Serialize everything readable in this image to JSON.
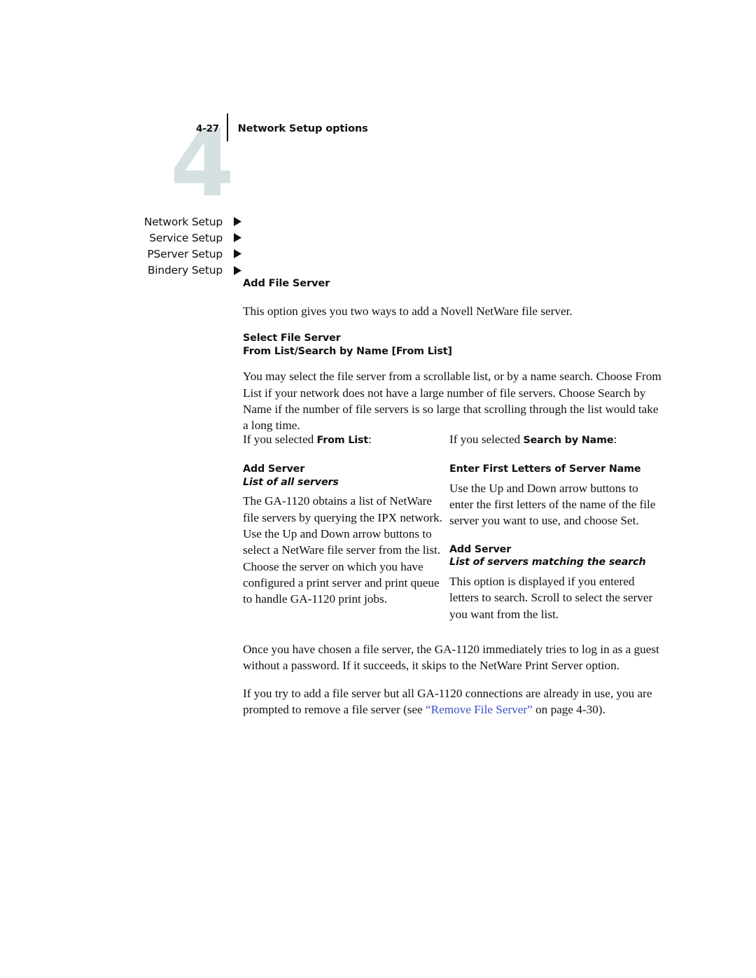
{
  "header": {
    "chapter_number": "4",
    "folio": "4-27",
    "title": "Network Setup options"
  },
  "breadcrumb": {
    "items": [
      {
        "label": "Network Setup",
        "arrow": "triangle-right-icon"
      },
      {
        "label": "Service Setup",
        "arrow": "triangle-right-icon"
      },
      {
        "label": "PServer Setup",
        "arrow": "triangle-right-icon"
      },
      {
        "label": "Bindery Setup",
        "arrow": "triangle-right-icon"
      }
    ]
  },
  "main": {
    "section_heading": "Add File Server",
    "intro_paragraph": "This option gives you two ways to add a Novell NetWare file server.",
    "option_select": {
      "name": "Select File Server",
      "values": "From List/Search by Name [From List]"
    },
    "description_paragraph": "You may select the file server from a scrollable list, or by a name search. Choose From List if your network does not have a large number of file servers. Choose Search by Name if the number of file servers is so large that scrolling through the list would take a long time.",
    "columns": {
      "left": {
        "intro_prefix": "If you selected ",
        "intro_bold": "From List",
        "intro_suffix": ":",
        "option_name": "Add Server",
        "option_values": "List of all servers",
        "body": "The GA-1120 obtains a list of NetWare file servers by querying the IPX network. Use the Up and Down arrow buttons to select a NetWare file server from the list. Choose the server on which you have configured a print server and print queue to handle GA-1120 print jobs."
      },
      "right": {
        "intro_prefix": "If you selected ",
        "intro_bold": "Search by Name",
        "intro_suffix": ":",
        "option_name_1": "Enter First Letters of Server Name",
        "body_1": "Use the Up and Down arrow buttons to enter the first letters of the name of the file server you want to use, and choose Set.",
        "option_name_2": "Add Server",
        "option_values_2": "List of servers matching the search",
        "body_2": "This option is displayed if you entered letters to search. Scroll to select the server you want from the list."
      }
    },
    "closing_paragraph_1": "Once you have chosen a file server, the GA-1120 immediately tries to log in as a guest without a password. If it succeeds, it skips to the NetWare Print Server option.",
    "closing_paragraph_2": {
      "before": "If you try to add a file server but all GA-1120 connections are already in use, you are prompted to remove a file server (see ",
      "xref": "“Remove File Server”",
      "after": " on page 4-30)."
    }
  },
  "colors": {
    "watermark": "#d6e0e0",
    "xref_link": "#3a4fc8",
    "text": "#111111"
  }
}
